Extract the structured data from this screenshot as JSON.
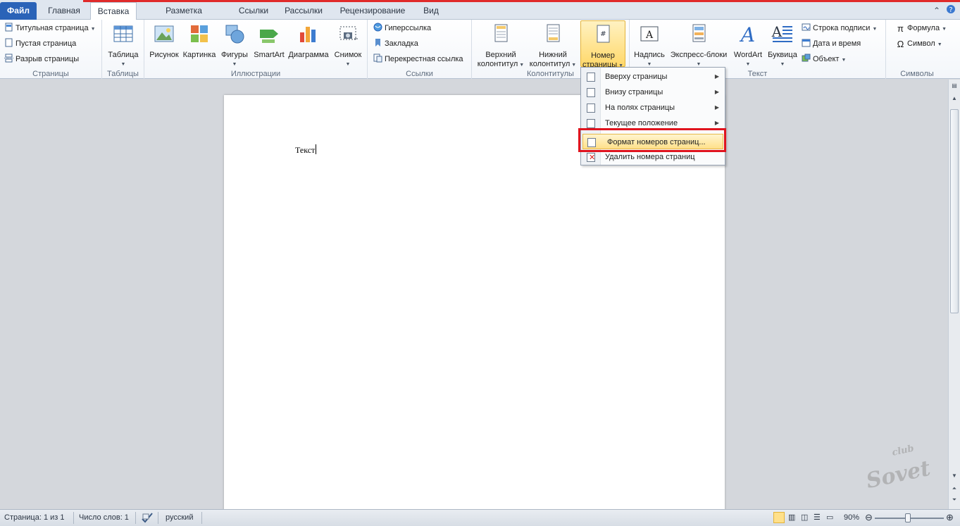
{
  "tabs": [
    {
      "label": "Файл",
      "kind": "file"
    },
    {
      "label": "Главная"
    },
    {
      "label": "Вставка",
      "active": true
    },
    {
      "label": "Разметка страницы"
    },
    {
      "label": "Ссылки"
    },
    {
      "label": "Рассылки"
    },
    {
      "label": "Рецензирование"
    },
    {
      "label": "Вид"
    }
  ],
  "ribbon": {
    "pages": {
      "label": "Страницы",
      "items": [
        "Титульная страница",
        "Пустая страница",
        "Разрыв страницы"
      ]
    },
    "tables": {
      "label": "Таблицы",
      "table": "Таблица"
    },
    "illustrations": {
      "label": "Иллюстрации",
      "items": [
        "Рисунок",
        "Картинка",
        "Фигуры",
        "SmartArt",
        "Диаграмма",
        "Снимок"
      ]
    },
    "links": {
      "label": "Ссылки",
      "items": [
        "Гиперссылка",
        "Закладка",
        "Перекрестная ссылка"
      ]
    },
    "headers": {
      "label": "Колонтитулы",
      "header_1": "Верхний",
      "header_2": "колонтитул",
      "footer_1": "Нижний",
      "footer_2": "колонтитул",
      "pagenum_1": "Номер",
      "pagenum_2": "страницы"
    },
    "text": {
      "label": "Текст",
      "items": [
        "Надпись",
        "Экспресс-блоки",
        "WordArt",
        "Буквица"
      ],
      "side": [
        "Строка подписи",
        "Дата и время",
        "Объект"
      ]
    },
    "symbols": {
      "label": "Символы",
      "items": [
        "Формула",
        "Символ"
      ]
    }
  },
  "menu": {
    "items": [
      {
        "label": "Вверху страницы",
        "submenu": true
      },
      {
        "label": "Внизу страницы",
        "submenu": true
      },
      {
        "label": "На полях страницы",
        "submenu": true
      },
      {
        "label": "Текущее положение",
        "submenu": true
      },
      {
        "label": "Формат номеров страниц...",
        "highlighted": true
      },
      {
        "label": "Удалить номера страниц"
      }
    ]
  },
  "document": {
    "text": "Текст"
  },
  "status": {
    "page": "Страница: 1 из 1",
    "words": "Число слов: 1",
    "language": "русский",
    "zoom": "90%"
  },
  "watermark": {
    "line1": "club",
    "line2": "Sovet"
  },
  "colors": {
    "accent": "#2a63b8",
    "highlight_box": "#e0141e"
  }
}
